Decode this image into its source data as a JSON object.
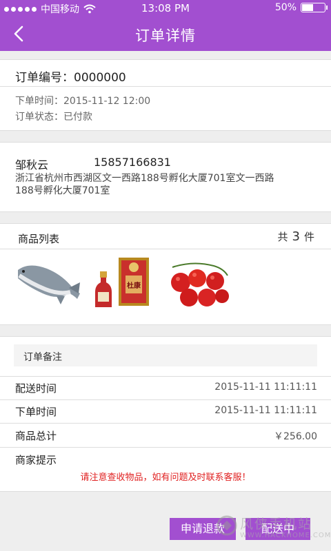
{
  "status_bar": {
    "carrier": "中国移动",
    "time": "13:08 PM",
    "battery_text": "50%",
    "battery_level": 0.5
  },
  "nav": {
    "title": "订单详情",
    "back_icon": "back-chevron-icon"
  },
  "order": {
    "number_label": "订单编号：",
    "number": "0000000",
    "time_label": "下单时间：",
    "time": "2015-11-12  12:00",
    "status_label": "订单状态：",
    "status": "已付款"
  },
  "customer": {
    "name": "邹秋云",
    "phone": "15857166831",
    "address": "浙江省杭州市西湖区文一西路188号孵化大厦701室文一西路188号孵化大厦701室"
  },
  "goods": {
    "header": "商品列表",
    "count_prefix": "共",
    "count": "3",
    "count_suffix": "件",
    "items": [
      "fish",
      "baijiu-bottle-box",
      "tomatoes"
    ],
    "box_text": "杜康"
  },
  "remarks": {
    "title": "订单备注",
    "delivery_time_label": "配送时间",
    "delivery_time": "2015-11-11   11:11:11",
    "order_time_label": "下单时间",
    "order_time": "2015-11-11   11:11:11",
    "total_label": "商品总计",
    "total": "￥256.00",
    "merchant_tip_label": "商家提示",
    "merchant_tip": "请注意查收物品，如有问题及时联系客服！"
  },
  "actions": {
    "refund": "申请退款",
    "delivering": "配送中"
  },
  "watermark": {
    "text": "风侠手机站",
    "url": "WWW.HACKHOME.COM"
  },
  "colors": {
    "brand": "#a24fd0",
    "warning": "#e02020"
  }
}
